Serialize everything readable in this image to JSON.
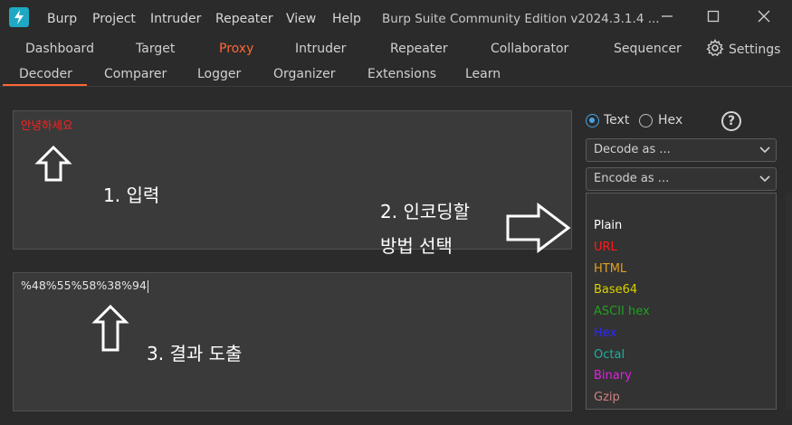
{
  "menu": {
    "items": [
      "Burp",
      "Project",
      "Intruder",
      "Repeater",
      "View",
      "Help"
    ],
    "window_title": "Burp Suite Community Edition v2024.3.1.4 ..."
  },
  "tabs_row1": [
    "Dashboard",
    "Target",
    "Proxy",
    "Intruder",
    "Repeater",
    "Collaborator",
    "Sequencer"
  ],
  "tabs_row2": [
    "Decoder",
    "Comparer",
    "Logger",
    "Organizer",
    "Extensions",
    "Learn"
  ],
  "settings_label": "Settings",
  "decoder": {
    "input_value": "안녕하세요",
    "output_value": "%48%55%58%38%94"
  },
  "annotations": {
    "step1": "1. 입력",
    "step2_line1": "2. 인코딩할",
    "step2_line2": "방법 선택",
    "step3": "3. 결과 도출"
  },
  "format": {
    "text_label": "Text",
    "hex_label": "Hex",
    "selected": "Text",
    "help_symbol": "?"
  },
  "decode_dropdown": "Decode as ...",
  "encode_dropdown": "Encode as ...",
  "encode_options": [
    {
      "label": "Plain",
      "color": "#ffffff"
    },
    {
      "label": "URL",
      "color": "#ff1a1a"
    },
    {
      "label": "HTML",
      "color": "#e0a020"
    },
    {
      "label": "Base64",
      "color": "#d8d000"
    },
    {
      "label": "ASCII hex",
      "color": "#20a020"
    },
    {
      "label": "Hex",
      "color": "#2a2aff"
    },
    {
      "label": "Octal",
      "color": "#20b0a0"
    },
    {
      "label": "Binary",
      "color": "#e020e0"
    },
    {
      "label": "Gzip",
      "color": "#d08080"
    }
  ],
  "colors": {
    "accent": "#ff6633",
    "panel_bg": "#3a3a3a",
    "window_bg": "#2b2b2b",
    "radio_selected": "#4aa3e6"
  }
}
